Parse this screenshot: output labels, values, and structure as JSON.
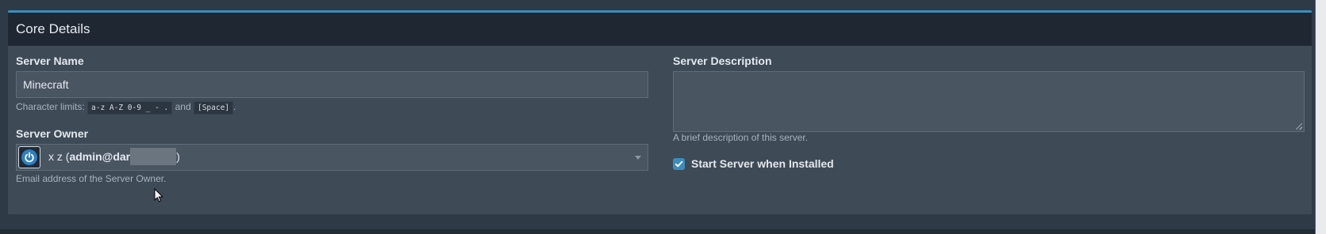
{
  "panel": {
    "title": "Core Details"
  },
  "server_name": {
    "label": "Server Name",
    "value": "Minecraft",
    "help_prefix": "Character limits:",
    "help_code_chars": "a-z A-Z 0-9 _ - .",
    "help_and": "and",
    "help_code_space": "[Space]",
    "help_suffix": "."
  },
  "server_owner": {
    "label": "Server Owner",
    "name": "x z",
    "email_visible": "admin@dar",
    "help": "Email address of the Server Owner.",
    "avatar_icon": "power-icon"
  },
  "server_description": {
    "label": "Server Description",
    "value": "",
    "help": "A brief description of this server."
  },
  "start_on_install": {
    "label": "Start Server when Installed",
    "checked": true
  },
  "colors": {
    "accent": "#3c8dbc",
    "header_bg": "#1f2832",
    "panel_bg": "#3e4a56",
    "input_bg": "#4a5562"
  }
}
